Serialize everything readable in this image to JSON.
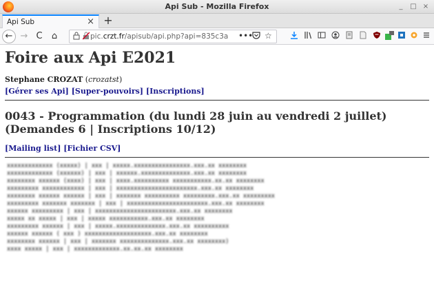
{
  "window": {
    "title": "Api Sub - Mozilla Firefox",
    "buttons": [
      "_",
      "□",
      "×"
    ]
  },
  "tabs": [
    {
      "label": "Api Sub",
      "close": "×"
    }
  ],
  "new_tab_label": "+",
  "nav": {
    "back": "←",
    "forward": "→",
    "reload": "C",
    "home": "⌂",
    "url_prefix": "pic.",
    "url_domain": "crzt.fr",
    "url_rest": "/apisub/api.php?api=835c3aee-a!",
    "page_actions": "•••",
    "pocket": "♡",
    "bookmark": "☆"
  },
  "page": {
    "title": "Foire aux Api E2021",
    "author_name": "Stephane CROZAT",
    "author_login": "crozatst",
    "links": [
      "[Gérer ses Api]",
      "[Super-pouvoirs]",
      "[Inscriptions]"
    ],
    "api_title": "0043 - Programmation (du lundi 28 juin au vendredi 2 juillet) (Demandes 6 | Inscriptions 10/12)",
    "sub_links": [
      "[Mailing list]",
      "[Fichier CSV]"
    ],
    "mailing_lines": [
      "xxxxxxxxxxxxx (xxxxx) | xxx | xxxxx.xxxxxxxxxxxxxxxx.xxx.xx xxxxxxxx",
      "xxxxxxxxxxxxx (xxxxxx) | xxx | xxxxxx.xxxxxxxxxxxxxx.xxx.xx xxxxxxxx",
      "xxxxxxxx xxxxxx (xxxx) | xxx | xxxx.xxxxxxxxxx xxxxxxxxxxx.xx.xx xxxxxxxx",
      "xxxxxxxxx xxxxxxxxxxxx | xxx | xxxxxxxxxxxxxxxxxxxxxxx.xxx.xx xxxxxxxx",
      "xxxxxxxx xxxxxx xxxxxx | xxx | xxxxxxx xxxxxxxxxx xxxxxxxxx.xxx.xx xxxxxxxxx",
      "xxxxxxxxx xxxxxxx xxxxxxx | xxx | xxxxxxxxxxxxxxxxxxxxxxx.xxx.xx xxxxxxxx",
      "xxxxxx xxxxxxxxx | xxx | xxxxxxxxxxxxxxxxxxxxxxx.xxx.xx xxxxxxxx",
      "xxxxx xx xxxxx | xxx | xxxxx xxxxxxxxxxx.xxx.xx xxxxxxxx",
      "xxxxxxxxx xxxxxx | xxx | xxxxx.xxxxxxxxxxxxxx.xxx.xx xxxxxxxxxx",
      "xxxxxx xxxxxx ( xxx ) xxxxxxxxxxxxxxxxxxx.xxx.xx xxxxxxxx",
      "xxxxxxxx xxxxxx | xxx | xxxxxxx xxxxxxxxxxxxxx.xxx.xx xxxxxxxx)",
      "xxxx xxxxx | xxx | xxxxxxxxxxxxx.xx.xx.xx xxxxxxxx"
    ]
  }
}
